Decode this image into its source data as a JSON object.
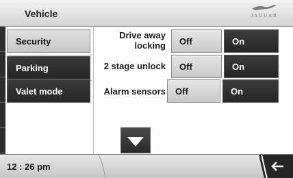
{
  "header": {
    "title": "Vehicle",
    "logo_text": "JAGUAR",
    "logo_icon": "leaper-icon"
  },
  "sidebar": {
    "items": [
      {
        "label": "Security",
        "selected": true
      },
      {
        "label": "Parking",
        "selected": false
      },
      {
        "label": "Valet mode",
        "selected": false
      }
    ]
  },
  "settings": {
    "rows": [
      {
        "label_line1": "Drive away",
        "label_line2": "locking",
        "off": "Off",
        "on": "On"
      },
      {
        "label": "2 stage unlock",
        "off": "Off",
        "on": "On"
      },
      {
        "label": "Alarm sensors",
        "off": "Off",
        "on": "On"
      }
    ]
  },
  "scroll": {
    "down_icon": "triangle-down-icon"
  },
  "footer": {
    "time": "12 : 26 pm",
    "back_icon": "arrow-left-icon"
  },
  "colors": {
    "dark": "#2a2a2a",
    "light": "#d6d6d6",
    "text_dark": "#1a1a1a"
  }
}
